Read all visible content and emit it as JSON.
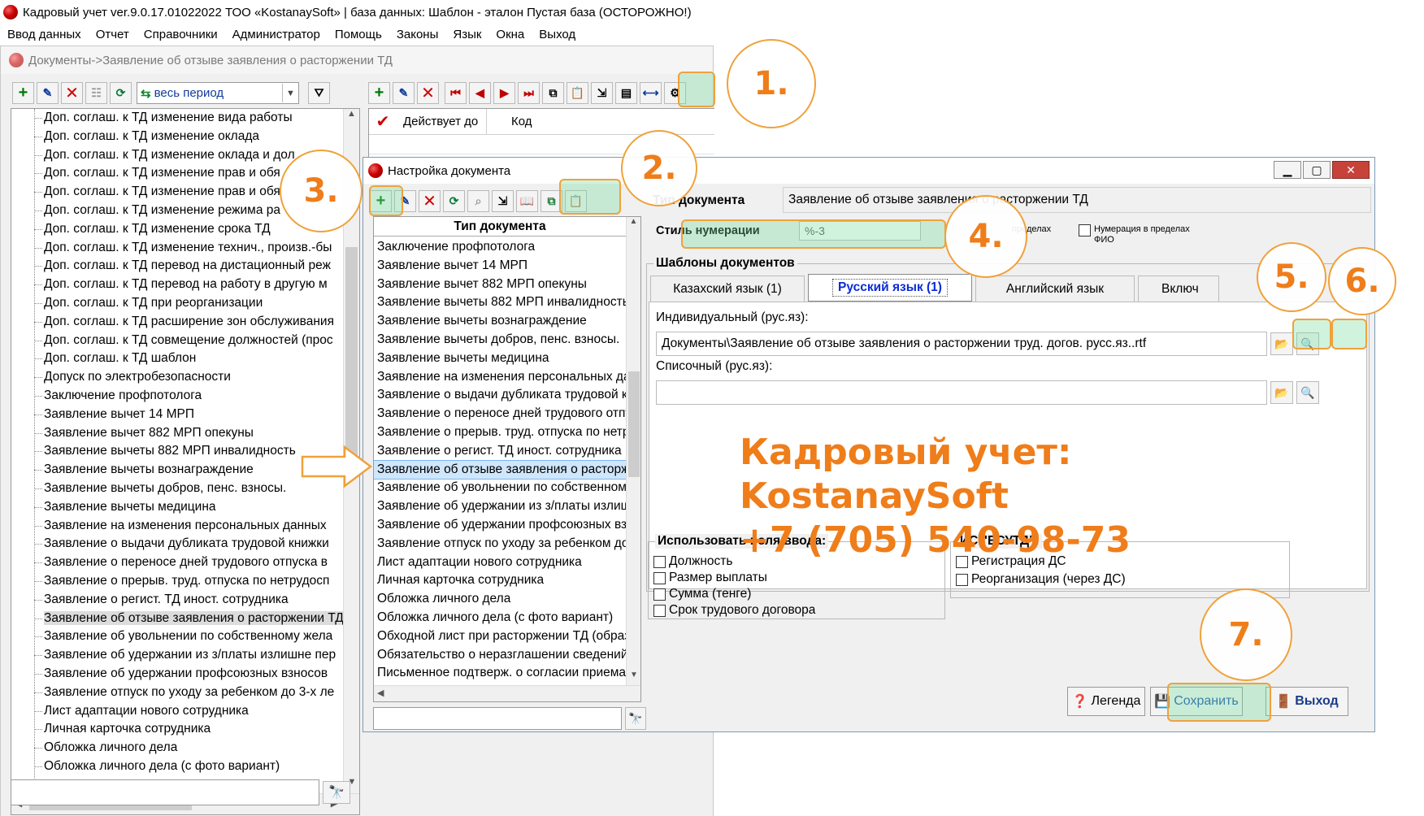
{
  "app": {
    "title": "Кадровый учет ver.9.0.17.01022022 ТОО «KostanaySoft» | база данных: Шаблон - эталон Пустая база (ОСТОРОЖНО!)"
  },
  "menu": [
    "Ввод данных",
    "Отчет",
    "Справочники",
    "Администратор",
    "Помощь",
    "Законы",
    "Язык",
    "Окна",
    "Выход"
  ],
  "docwin": {
    "title": "Документы->Заявление об отзыве заявления о расторжении ТД",
    "period": "весь период",
    "grid_headers": [
      "Действует до",
      "Код"
    ],
    "tree_items": [
      "Доп. соглаш. к ТД изменение вида работы",
      "Доп. соглаш. к ТД изменение оклада",
      "Доп. соглаш. к ТД изменение оклада и дол",
      "Доп. соглаш. к ТД изменение прав и обя",
      "Доп. соглаш. к ТД изменение прав и обя",
      "Доп. соглаш. к ТД изменение режима ра",
      "Доп. соглаш. к ТД изменение срока ТД",
      "Доп. соглаш. к ТД изменение технич., произв.-бы",
      "Доп. соглаш. к ТД перевод на дистационный реж",
      "Доп. соглаш. к ТД перевод на работу в другую м",
      "Доп. соглаш. к ТД при реорганизации",
      "Доп. соглаш. к ТД расширение зон обслуживания",
      "Доп. соглаш. к ТД совмещение должностей (прос",
      "Доп. соглаш. к ТД шаблон",
      "Допуск по электробезопасности",
      "Заключение профпотолога",
      "Заявление вычет 14 МРП",
      "Заявление вычет 882 МРП опекуны",
      "Заявление вычеты 882 МРП инвалидность",
      "Заявление вычеты вознаграждение",
      "Заявление вычеты добров, пенс. взносы.",
      "Заявление вычеты медицина",
      "Заявление на изменения персональных данных",
      "Заявление о выдачи дубликата трудовой книжки",
      "Заявление о переносе дней трудового отпуска в",
      "Заявление о прерыв. труд. отпуска по нетрудосп",
      "Заявление о регист. ТД иност. сотрудника",
      "Заявление об отзыве заявления о расторжении ТД",
      "Заявление об увольнении по собственному жела",
      "Заявление об удержании из з/платы излишне пер",
      "Заявление об удержании профсоюзных взносов",
      "Заявление отпуск по уходу за ребенком до 3-х ле",
      "Лист адаптации нового сотрудника",
      "Личная карточка сотрудника",
      "Обложка личного дела",
      "Обложка личного дела (с фото вариант)"
    ],
    "search_value": ""
  },
  "settings": {
    "title": "Настройка документа",
    "list_header": "Тип документа",
    "list_items": [
      "Заключение профпотолога",
      "Заявление вычет 14 МРП",
      "Заявление вычет 882 МРП опекуны",
      "Заявление вычеты 882 МРП инвалидность",
      "Заявление вычеты вознаграждение",
      "Заявление вычеты добров, пенс. взносы.",
      "Заявление вычеты медицина",
      "Заявление на изменения персональных данных",
      "Заявление о выдачи дубликата трудовой книжки",
      "Заявление о переносе дней трудового отпуска в",
      "Заявление о прерыв. труд. отпуска по нетрудосп",
      "Заявление о регист. ТД иност. сотрудника",
      "Заявление об отзыве заявления о расторжении",
      "Заявление об увольнении по собственному жел",
      "Заявление об удержании из з/платы излишне п",
      "Заявление об удержании профсоюзных взносов",
      "Заявление отпуск по уходу за ребенком до 3-х л",
      "Лист адаптации нового сотрудника",
      "Личная карточка сотрудника",
      "Обложка личного дела",
      "Обложка личного дела (с фото вариант)",
      "Обходной лист при расторжении ТД (образец)",
      "Обязательство о неразглашении сведений, отн",
      "Письменное подтверж. о согласии приема на р"
    ],
    "doc_type_label": "Тип документа",
    "doc_type_value": "Заявление об отзыве заявления о расторжении ТД",
    "numbering_label": "Стиль нумерации",
    "numbering_value": "%-3",
    "numbering_within": "пределах",
    "numbering_fio": "Нумерация в пределах ФИО",
    "templates_group": "Шаблоны документов",
    "tabs": [
      "Казахский язык (1)",
      "Русский язык (1)",
      "Английский язык",
      "Включ"
    ],
    "individual_label": "Индивидуальный (рус.яз):",
    "individual_value": "Документы\\Заявление об отзыве заявления о расторжении труд. догов. русс.яз..rtf",
    "list_label": "Списочный (рус.яз):",
    "list_value": "",
    "fields_group": "Использовать поля ввода:",
    "fields": [
      "Должность",
      "Размер выплаты",
      "Сумма (тенге)",
      "Срок трудового договора"
    ],
    "esutd_group": "ИС \"ЕСУТД\":",
    "esutd": [
      "Регистрация ДС",
      "Реорганизация (через ДС)"
    ],
    "btn_legend": "Легенда",
    "btn_save": "Сохранить",
    "btn_exit": "Выход"
  },
  "callouts": [
    "1.",
    "2.",
    "3.",
    "4.",
    "5.",
    "6.",
    "7."
  ],
  "promo": {
    "line1": "Кадровый учет:",
    "line2": "KostanaySoft",
    "line3": "+7 (705) 540-98-73"
  },
  "colors": {
    "accent": "#ef7d1a",
    "highlight": "#78dca0",
    "selected_blue": "#0a2bd6"
  }
}
